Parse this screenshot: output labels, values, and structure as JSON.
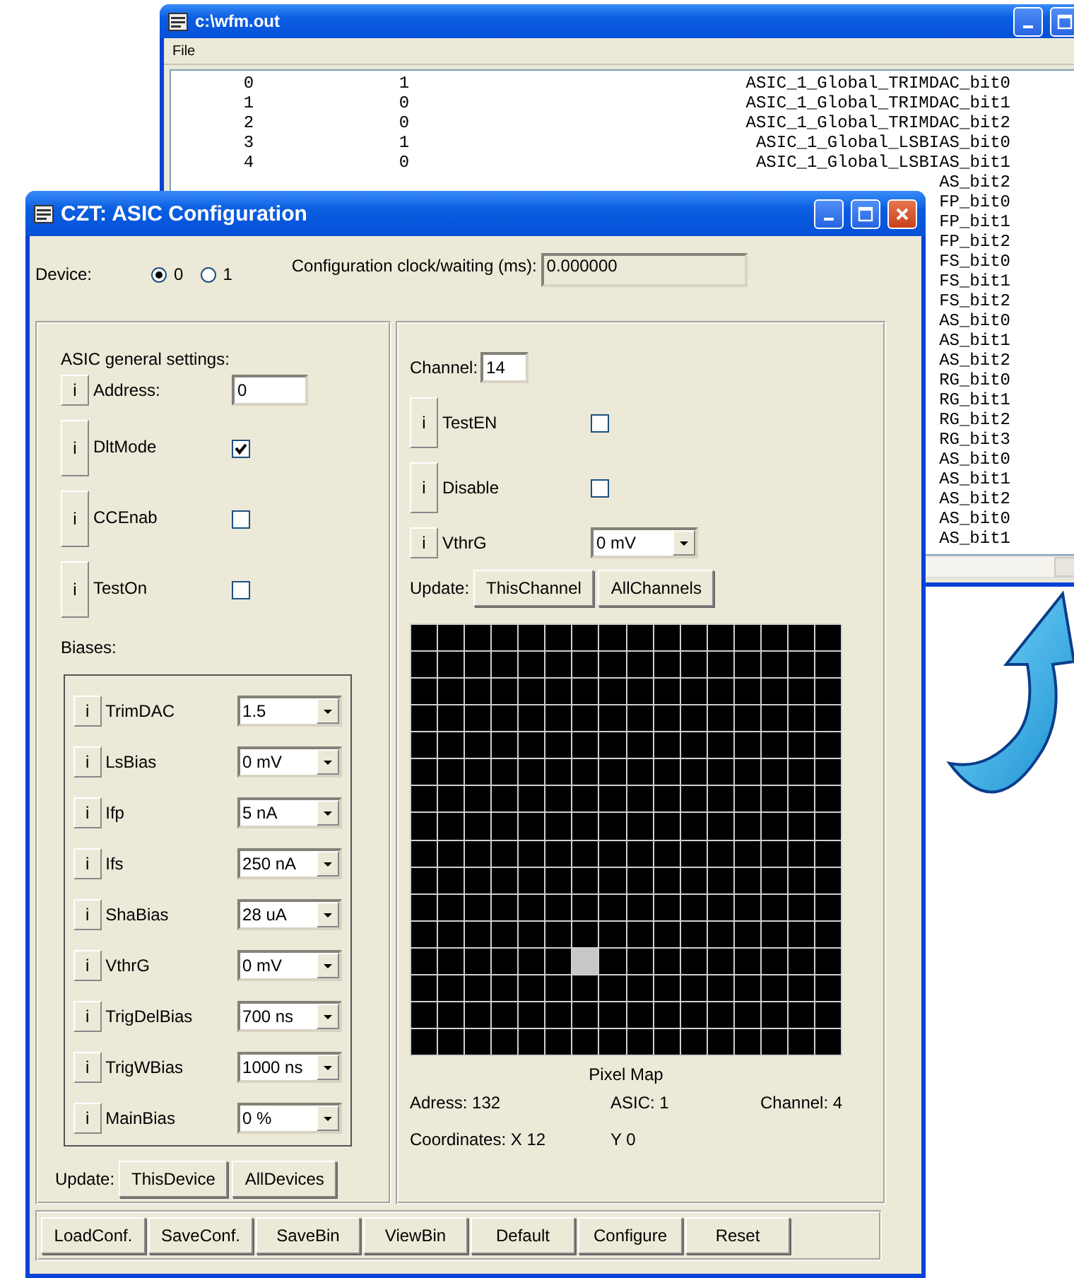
{
  "background_window": {
    "title": "c:\\wfm.out",
    "menu": [
      "File"
    ],
    "rows": [
      {
        "index": "0",
        "value": "1",
        "name": "ASIC_1_Global_TRIMDAC_bit0"
      },
      {
        "index": "1",
        "value": "0",
        "name": "ASIC_1_Global_TRIMDAC_bit1"
      },
      {
        "index": "2",
        "value": "0",
        "name": "ASIC_1_Global_TRIMDAC_bit2"
      },
      {
        "index": "3",
        "value": "1",
        "name": "ASIC_1_Global_LSBIAS_bit0"
      },
      {
        "index": "4",
        "value": "0",
        "name": "ASIC_1_Global_LSBIAS_bit1"
      }
    ],
    "covered_rows": [
      "AS_bit2",
      "FP_bit0",
      "FP_bit1",
      "FP_bit2",
      "FS_bit0",
      "FS_bit1",
      "FS_bit2",
      "AS_bit0",
      "AS_bit1",
      "AS_bit2",
      "RG_bit0",
      "RG_bit1",
      "RG_bit2",
      "RG_bit3",
      "AS_bit0",
      "AS_bit1",
      "AS_bit2",
      "AS_bit0",
      "AS_bit1"
    ]
  },
  "window": {
    "title": "CZT: ASIC Configuration",
    "device": {
      "label": "Device:",
      "options": [
        {
          "label": "0",
          "selected": true
        },
        {
          "label": "1",
          "selected": false
        }
      ]
    },
    "clock": {
      "label": "Configuration clock/waiting (ms):",
      "value": "0.000000"
    },
    "general": {
      "title": "ASIC general settings:",
      "items": [
        {
          "kind": "text",
          "button": "i",
          "label": "Address:",
          "value": "0"
        },
        {
          "kind": "checkbox",
          "button": "i",
          "label": "DltMode",
          "checked": true
        },
        {
          "kind": "checkbox",
          "button": "i",
          "label": "CCEnab",
          "checked": false
        },
        {
          "kind": "checkbox",
          "button": "i",
          "label": "TestOn",
          "checked": false
        }
      ]
    },
    "biases": {
      "title": "Biases:",
      "items": [
        {
          "button": "i",
          "label": "TrimDAC",
          "value": "1.5"
        },
        {
          "button": "i",
          "label": "LsBias",
          "value": "0 mV"
        },
        {
          "button": "i",
          "label": "Ifp",
          "value": "5 nA"
        },
        {
          "button": "i",
          "label": "Ifs",
          "value": "250 nA"
        },
        {
          "button": "i",
          "label": "ShaBias",
          "value": "28 uA"
        },
        {
          "button": "i",
          "label": "VthrG",
          "value": "0 mV"
        },
        {
          "button": "i",
          "label": "TrigDelBias",
          "value": "700 ns"
        },
        {
          "button": "i",
          "label": "TrigWBias",
          "value": "1000 ns"
        },
        {
          "button": "i",
          "label": "MainBias",
          "value": "0 %"
        }
      ]
    },
    "device_update": {
      "label": "Update:",
      "buttons": [
        "ThisDevice",
        "AllDevices"
      ]
    },
    "channel": {
      "label": "Channel:",
      "value": "14",
      "items": [
        {
          "kind": "checkbox",
          "button": "i",
          "label": "TestEN",
          "checked": false
        },
        {
          "kind": "checkbox",
          "button": "i",
          "label": "Disable",
          "checked": false
        },
        {
          "kind": "combo",
          "button": "i",
          "label": "VthrG",
          "value": "0 mV"
        }
      ]
    },
    "channel_update": {
      "label": "Update:",
      "buttons": [
        "ThisChannel",
        "AllChannels"
      ]
    },
    "pixel_map": {
      "title": "Pixel Map",
      "rows": [
        [
          false,
          false,
          false,
          false,
          false,
          false,
          false,
          false,
          false,
          false,
          false,
          false,
          false,
          false,
          false,
          false
        ],
        [
          false,
          false,
          false,
          false,
          false,
          false,
          false,
          false,
          false,
          false,
          false,
          false,
          false,
          false,
          false,
          false
        ],
        [
          false,
          false,
          false,
          false,
          false,
          false,
          false,
          false,
          false,
          false,
          false,
          false,
          false,
          false,
          false,
          false
        ],
        [
          false,
          false,
          false,
          false,
          false,
          false,
          false,
          false,
          false,
          false,
          false,
          false,
          false,
          false,
          false,
          false
        ],
        [
          false,
          false,
          false,
          false,
          false,
          false,
          false,
          false,
          false,
          false,
          false,
          false,
          false,
          false,
          false,
          false
        ],
        [
          false,
          false,
          false,
          false,
          false,
          false,
          false,
          false,
          false,
          false,
          false,
          false,
          false,
          false,
          false,
          false
        ],
        [
          false,
          false,
          false,
          false,
          false,
          false,
          false,
          false,
          false,
          false,
          false,
          false,
          false,
          false,
          false,
          false
        ],
        [
          false,
          false,
          false,
          false,
          false,
          false,
          false,
          false,
          false,
          false,
          false,
          false,
          false,
          false,
          false,
          false
        ],
        [
          false,
          false,
          false,
          false,
          false,
          false,
          false,
          false,
          false,
          false,
          false,
          false,
          false,
          false,
          false,
          false
        ],
        [
          false,
          false,
          false,
          false,
          false,
          false,
          false,
          false,
          false,
          false,
          false,
          false,
          false,
          false,
          false,
          false
        ],
        [
          false,
          false,
          false,
          false,
          false,
          false,
          false,
          false,
          false,
          false,
          false,
          false,
          false,
          false,
          false,
          false
        ],
        [
          false,
          false,
          false,
          false,
          false,
          false,
          false,
          false,
          false,
          false,
          false,
          false,
          false,
          false,
          false,
          false
        ],
        [
          false,
          false,
          false,
          false,
          false,
          false,
          true,
          false,
          false,
          false,
          false,
          false,
          false,
          false,
          false,
          false
        ],
        [
          false,
          false,
          false,
          false,
          false,
          false,
          false,
          false,
          false,
          false,
          false,
          false,
          false,
          false,
          false,
          false
        ],
        [
          false,
          false,
          false,
          false,
          false,
          false,
          false,
          false,
          false,
          false,
          false,
          false,
          false,
          false,
          false,
          false
        ],
        [
          false,
          false,
          false,
          false,
          false,
          false,
          false,
          false,
          false,
          false,
          false,
          false,
          false,
          false,
          false,
          false
        ]
      ],
      "info": [
        "Adress: 132",
        "ASIC: 1",
        "Channel: 4"
      ],
      "coordinates": [
        "Coordinates: X 12",
        "Y 0"
      ]
    },
    "buttons": [
      "LoadConf.",
      "SaveConf.",
      "SaveBin",
      "ViewBin",
      "Default",
      "Configure",
      "Reset"
    ]
  }
}
